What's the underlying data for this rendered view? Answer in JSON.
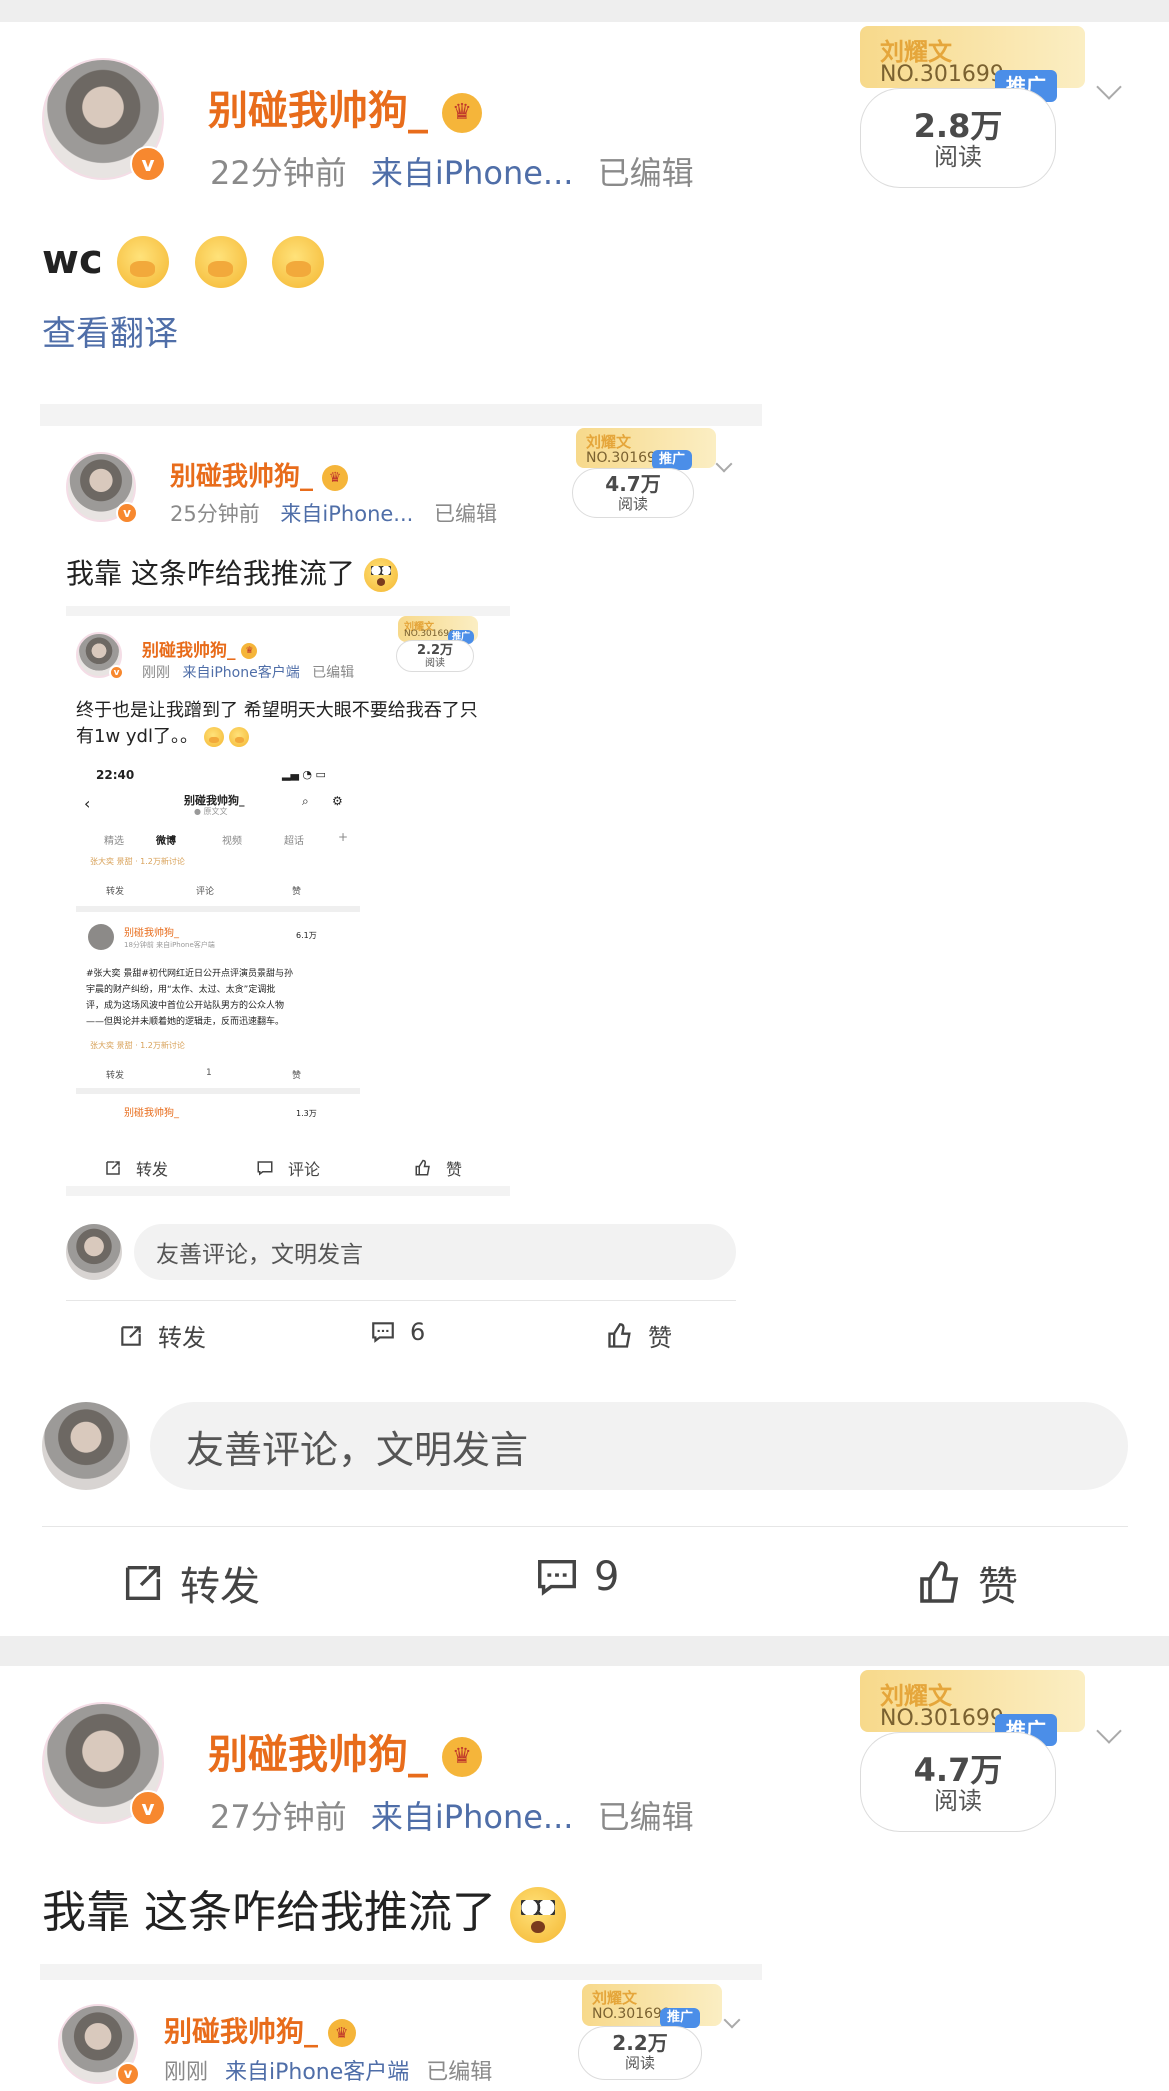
{
  "colors": {
    "username": "#e86c1b",
    "link": "#4f6ea8",
    "meta": "#8a8a8a",
    "promo_tag": "#4b8ee8",
    "badge": "#f7882f"
  },
  "post1": {
    "username": "别碰我帅狗_",
    "time": "22分钟前",
    "source": "来自iPhone...",
    "edited": "已编辑",
    "promo": {
      "name": "刘耀文",
      "no": "NO.301699",
      "tag": "推广",
      "count": "2.8万",
      "read": "阅读"
    },
    "text": "wc",
    "translate": "查看翻译",
    "comment_placeholder": "友善评论，文明发言",
    "repost_label": "转发",
    "comment_count": "9",
    "like_label": "赞"
  },
  "repost1": {
    "username": "别碰我帅狗_",
    "time": "25分钟前",
    "source": "来自iPhone...",
    "edited": "已编辑",
    "promo": {
      "name": "刘耀文",
      "no": "NO.301699",
      "tag": "推广",
      "count": "4.7万",
      "read": "阅读"
    },
    "text": "我靠 这条咋给我推流了",
    "comment_placeholder": "友善评论，文明发言",
    "repost_label": "转发",
    "comment_count": "6",
    "like_label": "赞"
  },
  "repost2": {
    "username": "别碰我帅狗_",
    "time": "刚刚",
    "source": "来自iPhone客户端",
    "edited": "已编辑",
    "promo": {
      "name": "刘耀文",
      "no": "NO.301699",
      "tag": "推广",
      "count": "2.2万",
      "read": "阅读"
    },
    "text_line1": "终于也是让我蹭到了 希望明天大眼不要给我吞了只",
    "text_line2": "有1w ydl了。。",
    "repost_label": "转发",
    "comment_label": "评论",
    "like_label": "赞"
  },
  "screenshot": {
    "status_time": "22:40",
    "profile_name": "别碰我帅狗_",
    "profile_sub": "● 原文文",
    "tabs": [
      "精选",
      "微博",
      "视频",
      "超话",
      "+"
    ],
    "hot_tag": "张大奕 景甜 · 1.2万新讨论",
    "post_name": "别碰我帅狗_",
    "post_meta": "18分钟前  来自iPhone客户端",
    "post_count": "6.1万",
    "post_line1": "#张大奕 景甜#初代网红近日公开点评演员景甜与孙",
    "post_line2": "宇晨的财产纠纷，用“太作、太过、太贪”定调批",
    "post_line3": "评，成为这场风波中首位公开站队男方的公众人物",
    "post_line4": "——但舆论并未顺着她的逻辑走，反而迅速翻车。",
    "hot_tag2": "张大奕 景甜 · 1.2万新讨论",
    "actions": [
      "转发",
      "评论",
      "赞"
    ],
    "actions2": [
      "转发",
      "1",
      "赞"
    ],
    "post3_name": "别碰我帅狗_",
    "post3_count": "1.3万"
  },
  "post2": {
    "username": "别碰我帅狗_",
    "time": "27分钟前",
    "source": "来自iPhone...",
    "edited": "已编辑",
    "promo": {
      "name": "刘耀文",
      "no": "NO.301699",
      "tag": "推广",
      "count": "4.7万",
      "read": "阅读"
    },
    "text": "我靠 这条咋给我推流了"
  },
  "repost3": {
    "username": "别碰我帅狗_",
    "time": "刚刚",
    "source": "来自iPhone客户端",
    "edited": "已编辑",
    "promo": {
      "name": "刘耀文",
      "no": "NO.301699",
      "tag": "推广",
      "count": "2.2万",
      "read": "阅读"
    }
  }
}
